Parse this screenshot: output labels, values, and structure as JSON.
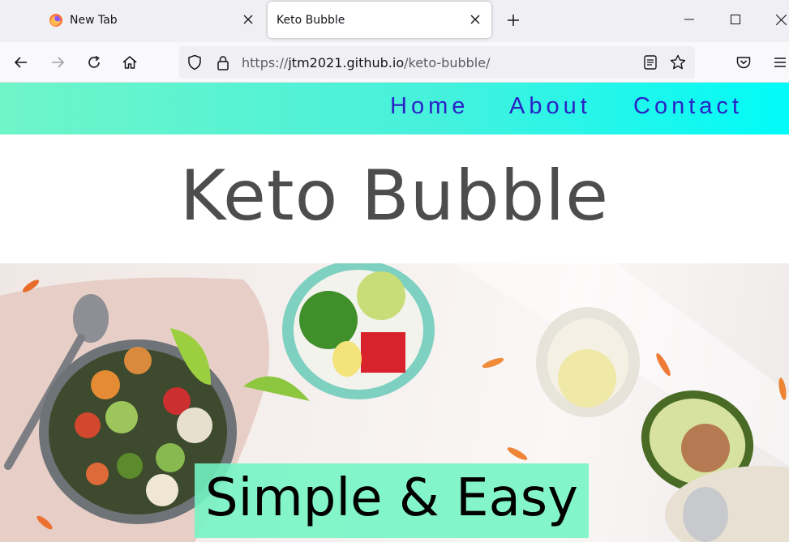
{
  "browser": {
    "tabs": [
      {
        "title": "New Tab",
        "active": false,
        "icon": "firefox-icon"
      },
      {
        "title": "Keto Bubble",
        "active": true
      }
    ],
    "address_bar": {
      "scheme": "https://",
      "host": "jtm2021.github.io",
      "path": "/keto-bubble/"
    }
  },
  "site": {
    "nav": {
      "home": "Home",
      "about": "About",
      "contact": "Contact"
    },
    "title": "Keto Bubble",
    "tagline": "Simple & Easy"
  },
  "colors": {
    "header_gradient_start": "#6ff5c8",
    "header_gradient_end": "#00fbf8",
    "nav_link": "#2a22c6",
    "title": "#4d4d4d",
    "tagline_bg": "#73f5c4"
  }
}
